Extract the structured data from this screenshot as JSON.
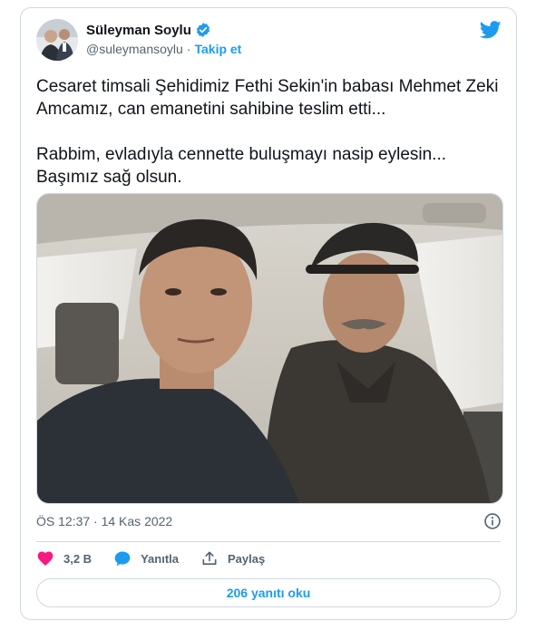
{
  "author": {
    "name": "Süleyman Soylu",
    "handle": "@suleymansoylu",
    "separator": "·",
    "follow_label": "Takip et",
    "verified": true
  },
  "tweet": {
    "paragraphs": [
      "Cesaret timsali Şehidimiz Fethi Sekin'in babası Mehmet Zeki Amcamız, can emanetini sahibine teslim etti...",
      "Rabbim, evladıyla cennette buluşmayı nasip eylesin... Başımız sağ olsun."
    ],
    "timestamp": "ÖS 12:37 · 14 Kas 2022"
  },
  "actions": {
    "like_count": "3,2 B",
    "reply_label": "Yanıtla",
    "share_label": "Paylaş"
  },
  "read_replies_label": "206 yanıtı oku",
  "colors": {
    "accent": "#1d9bf0",
    "like": "#f91880",
    "text": "#0f1419",
    "muted": "#536471",
    "border": "#cfd9de"
  },
  "icons": [
    "verified-badge-icon",
    "twitter-bird-icon",
    "info-icon",
    "heart-icon",
    "reply-bubble-icon",
    "share-icon"
  ]
}
